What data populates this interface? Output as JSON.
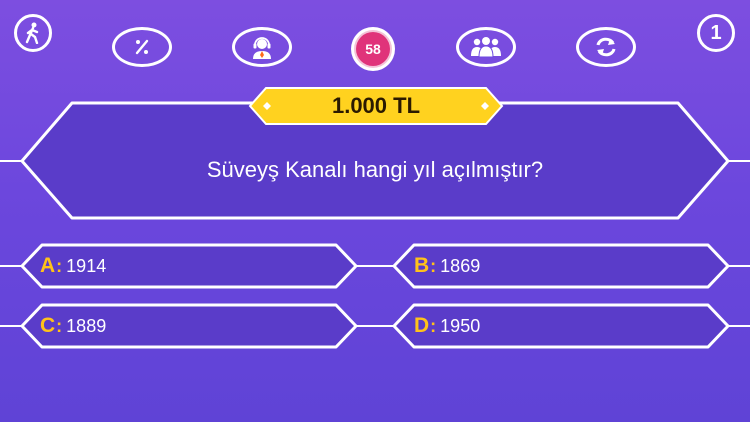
{
  "header": {
    "walk_away_icon": "walk-away-icon",
    "fifty_fifty_icon": "percent-icon",
    "phone_icon": "support-agent-icon",
    "timer": "58",
    "audience_icon": "audience-icon",
    "switch_icon": "switch-question-icon",
    "question_number": "1"
  },
  "prize": "1.000 TL",
  "question": "Süveyş Kanalı hangi yıl açılmıştır?",
  "answers": [
    {
      "letter": "A",
      "sep": ":",
      "text": "1914"
    },
    {
      "letter": "B",
      "sep": ":",
      "text": "1869"
    },
    {
      "letter": "C",
      "sep": ":",
      "text": "1889"
    },
    {
      "letter": "D",
      "sep": ":",
      "text": "1950"
    }
  ],
  "colors": {
    "background_top": "#7d4ee0",
    "background_bottom": "#5f43d6",
    "panel": "#5a3cc9",
    "prize_gold": "#ffd21f",
    "letter_gold": "#ffc21a",
    "timer_pink": "#e0337a"
  }
}
